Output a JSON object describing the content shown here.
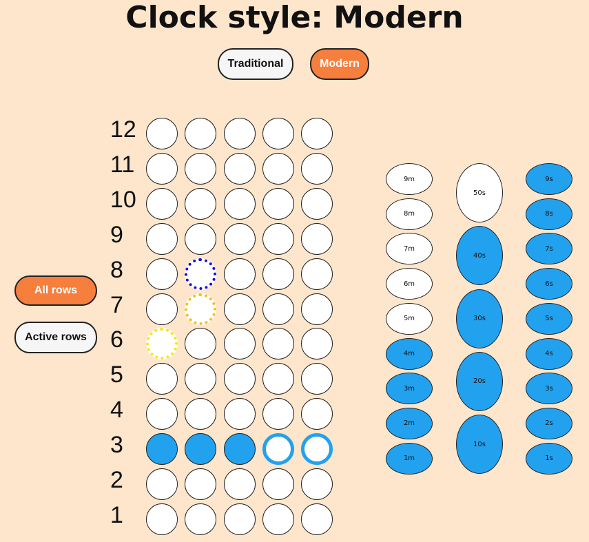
{
  "page": {
    "title": "Clock style: Modern"
  },
  "style_buttons": {
    "traditional": "Traditional",
    "modern": "Modern",
    "selected": "modern"
  },
  "row_buttons": {
    "all_rows": "All rows",
    "active_rows": "Active rows",
    "selected": "all_rows"
  },
  "colors": {
    "background": "#fde6cb",
    "accent": "#f67f3e",
    "active_blue": "#22a1ef",
    "hour_8_marker": "#1010dd",
    "hour_7_marker": "#f0c020",
    "hour_6_marker": "#f2e818"
  },
  "hours": {
    "rows": [
      {
        "label": "12",
        "dots": [
          "empty",
          "empty",
          "empty",
          "empty",
          "empty"
        ]
      },
      {
        "label": "11",
        "dots": [
          "empty",
          "empty",
          "empty",
          "empty",
          "empty"
        ]
      },
      {
        "label": "10",
        "dots": [
          "empty",
          "empty",
          "empty",
          "empty",
          "empty"
        ]
      },
      {
        "label": "9",
        "dots": [
          "empty",
          "empty",
          "empty",
          "empty",
          "empty"
        ]
      },
      {
        "label": "8",
        "dots": [
          "empty",
          "dotted-blue",
          "empty",
          "empty",
          "empty"
        ]
      },
      {
        "label": "7",
        "dots": [
          "empty",
          "dotted-gold",
          "empty",
          "empty",
          "empty"
        ]
      },
      {
        "label": "6",
        "dots": [
          "dotted-yellow",
          "empty",
          "empty",
          "empty",
          "empty"
        ]
      },
      {
        "label": "5",
        "dots": [
          "empty",
          "empty",
          "empty",
          "empty",
          "empty"
        ]
      },
      {
        "label": "4",
        "dots": [
          "empty",
          "empty",
          "empty",
          "empty",
          "empty"
        ]
      },
      {
        "label": "3",
        "dots": [
          "filled",
          "filled",
          "filled",
          "ring",
          "ring"
        ]
      },
      {
        "label": "2",
        "dots": [
          "empty",
          "empty",
          "empty",
          "empty",
          "empty"
        ]
      },
      {
        "label": "1",
        "dots": [
          "empty",
          "empty",
          "empty",
          "empty",
          "empty"
        ]
      }
    ]
  },
  "minutes": {
    "items": [
      {
        "label": "9m",
        "lit": false
      },
      {
        "label": "8m",
        "lit": false
      },
      {
        "label": "7m",
        "lit": false
      },
      {
        "label": "6m",
        "lit": false
      },
      {
        "label": "5m",
        "lit": false
      },
      {
        "label": "4m",
        "lit": true
      },
      {
        "label": "3m",
        "lit": true
      },
      {
        "label": "2m",
        "lit": true
      },
      {
        "label": "1m",
        "lit": true
      }
    ]
  },
  "tens_seconds": {
    "items": [
      {
        "label": "50s",
        "lit": false
      },
      {
        "label": "40s",
        "lit": true
      },
      {
        "label": "30s",
        "lit": true
      },
      {
        "label": "20s",
        "lit": true
      },
      {
        "label": "10s",
        "lit": true
      }
    ]
  },
  "seconds": {
    "items": [
      {
        "label": "9s",
        "lit": true
      },
      {
        "label": "8s",
        "lit": true
      },
      {
        "label": "7s",
        "lit": true
      },
      {
        "label": "6s",
        "lit": true
      },
      {
        "label": "5s",
        "lit": true
      },
      {
        "label": "4s",
        "lit": true
      },
      {
        "label": "3s",
        "lit": true
      },
      {
        "label": "2s",
        "lit": true
      },
      {
        "label": "1s",
        "lit": true
      }
    ]
  }
}
